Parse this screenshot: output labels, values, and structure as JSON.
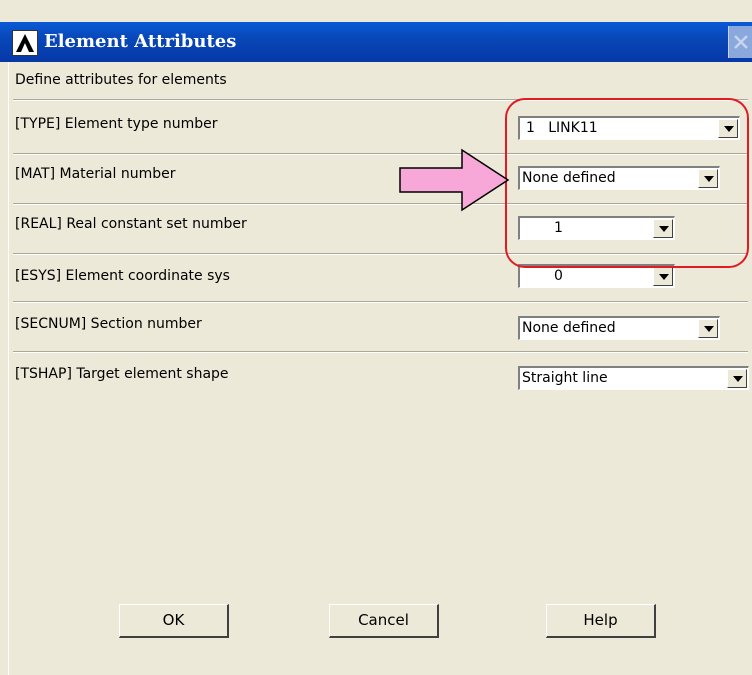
{
  "window": {
    "title": "Element Attributes",
    "header": "Define attributes for elements"
  },
  "rows": [
    {
      "label": "[TYPE]  Element type number",
      "value": "1   LINK11"
    },
    {
      "label": "[MAT]  Material number",
      "value": "None defined"
    },
    {
      "label": "[REAL]  Real constant set number",
      "value": "1"
    },
    {
      "label": "[ESYS]  Element coordinate sys",
      "value": "0"
    },
    {
      "label": "[SECNUM]  Section number",
      "value": "None defined"
    },
    {
      "label": "[TSHAP]  Target element shape",
      "value": "Straight line"
    }
  ],
  "buttons": {
    "ok": "OK",
    "cancel": "Cancel",
    "help": "Help"
  },
  "annotations": {
    "arrow_color": "#f8a8d8",
    "highlight_color": "#e01b24"
  }
}
